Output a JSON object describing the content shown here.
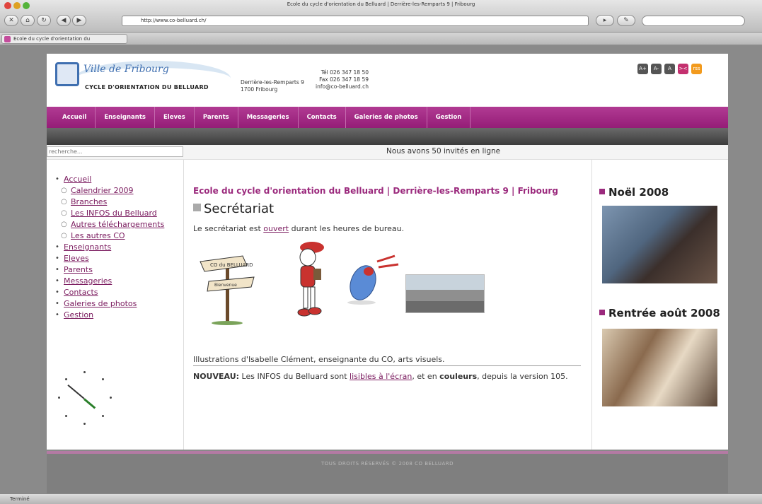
{
  "browser": {
    "window_title": "Ecole du cycle d'orientation du Belluard | Derrière-les-Remparts 9 | Fribourg",
    "url": "http://www.co-belluard.ch/",
    "tab_title": "Ecole du cycle d'orientation du",
    "status": "Terminé"
  },
  "header": {
    "logo_title": "Ville de Fribourg",
    "logo_subtitle": "CYCLE D'ORIENTATION DU BELLUARD",
    "address_line1": "Derrière-les-Remparts 9",
    "address_line2": "1700 Fribourg",
    "tel": "Tél 026 347 18 50",
    "fax": "Fax 026 347 18 59",
    "email": "info@co-belluard.ch",
    "share_buttons": [
      "A+",
      "A-",
      "A",
      "><",
      "rss"
    ]
  },
  "menu": [
    "Accueil",
    "Enseignants",
    "Eleves",
    "Parents",
    "Messageries",
    "Contacts",
    "Galeries de photos",
    "Gestion"
  ],
  "search": {
    "placeholder": "recherche..."
  },
  "guests_online": "Nous avons 50 invités en ligne",
  "left_nav": {
    "accueil": "Accueil",
    "accueil_children": [
      "Calendrier 2009",
      "Branches",
      "Les INFOS du Belluard",
      "Autres téléchargements",
      "Les autres CO"
    ],
    "items": [
      "Enseignants",
      "Eleves",
      "Parents",
      "Messageries",
      "Contacts",
      "Galeries de photos",
      "Gestion"
    ]
  },
  "content": {
    "breadcrumb": "Ecole du cycle d'orientation du Belluard | Derrière-les-Remparts 9 | Fribourg",
    "title": "Secrétariat",
    "desc_before": "Le secrétariat est ",
    "desc_link": "ouvert",
    "desc_after": " durant les heures de bureau.",
    "caption": "Illustrations d'Isabelle Clément, enseignante du CO, arts visuels.",
    "news_label": "NOUVEAU:",
    "news_text1": " Les INFOS du Belluard sont ",
    "news_link": "lisibles à l'écran",
    "news_text2": ", et en ",
    "news_bold": "couleurs",
    "news_text3": ", depuis la version 105.",
    "sign_1": "CO du BELLUARD",
    "sign_2": "Bienvenue"
  },
  "right": {
    "h1": "Noël 2008",
    "h2": "Rentrée août 2008"
  },
  "footer": "TOUS DROITS RÉSERVÉS © 2008 CO BELLUARD"
}
